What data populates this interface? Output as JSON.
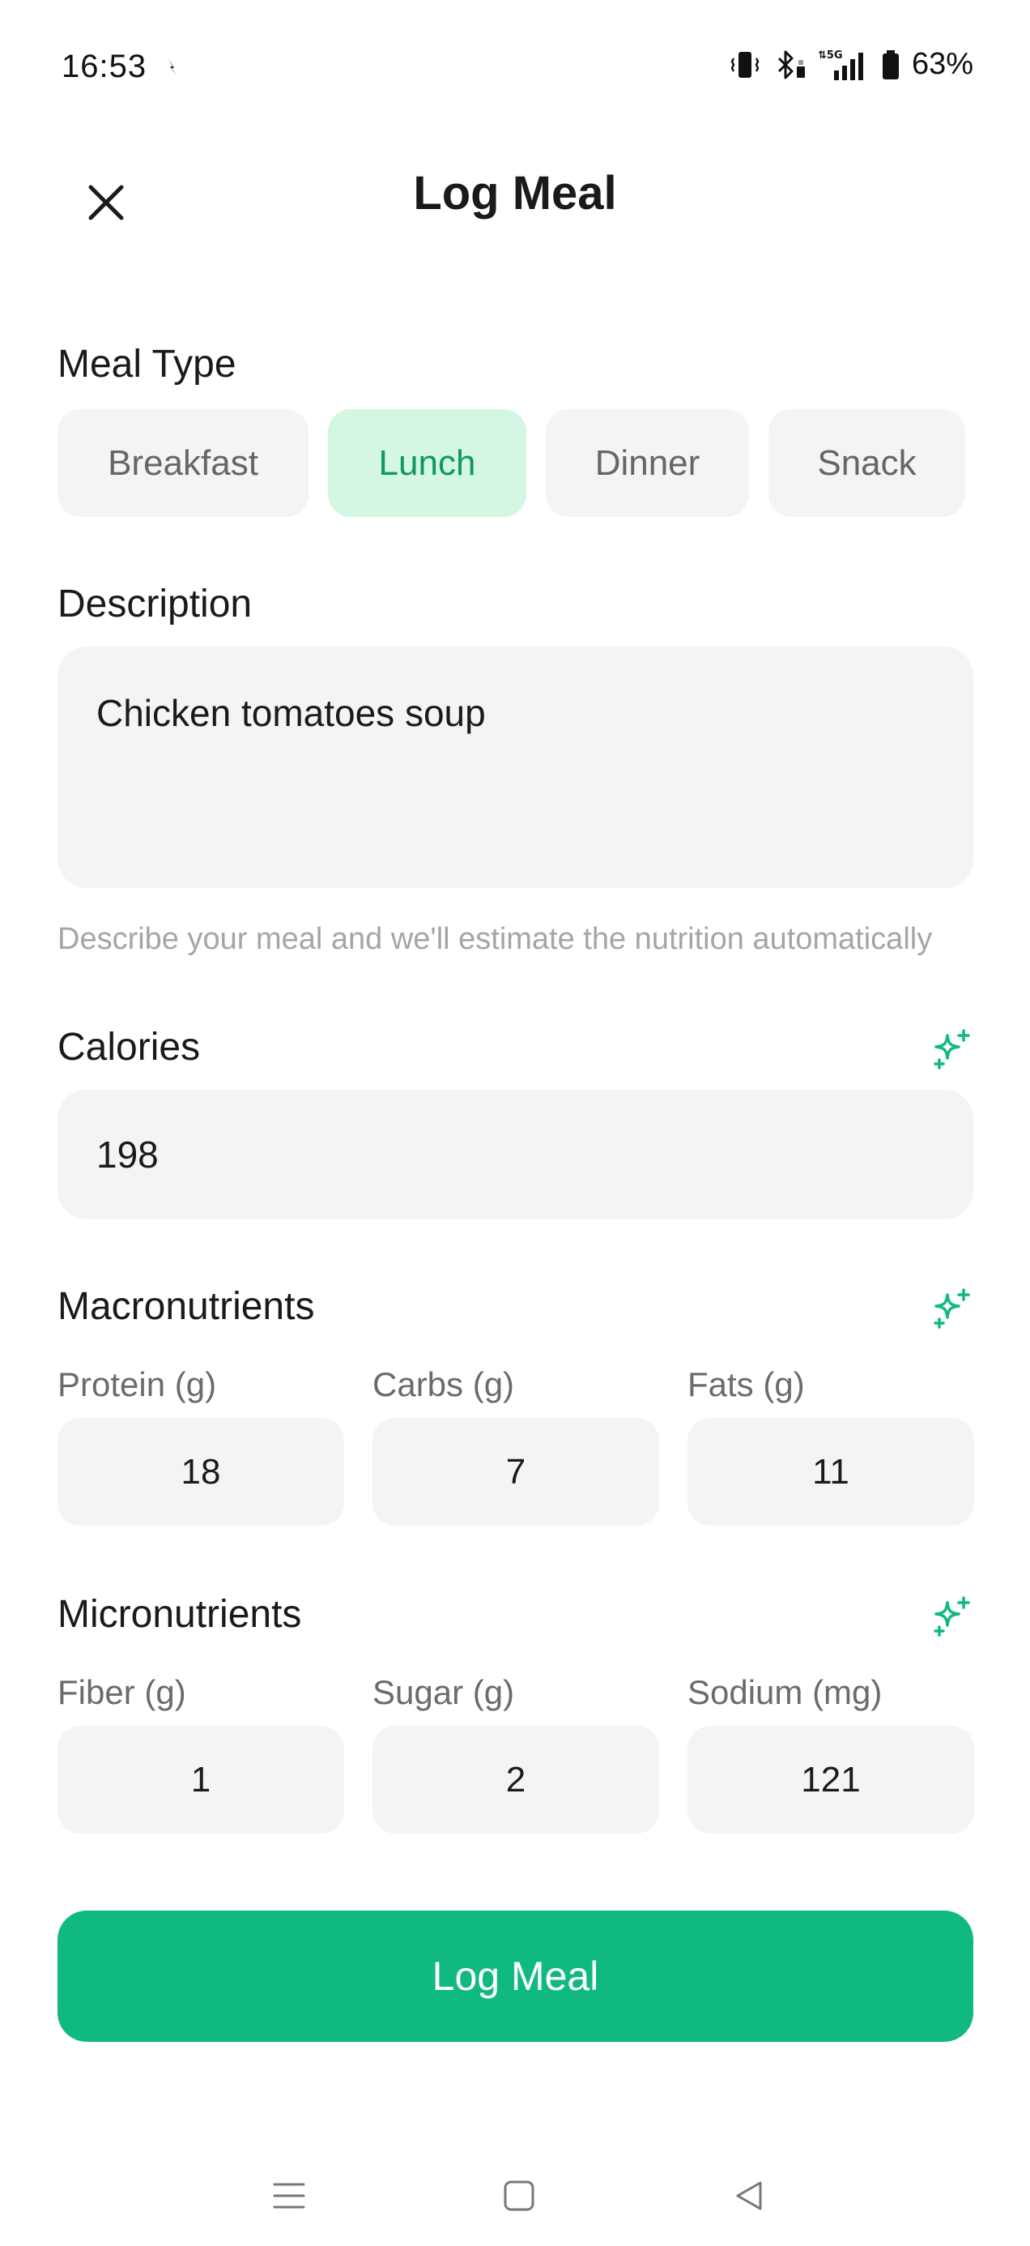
{
  "status_bar": {
    "time": "16:53",
    "battery": "63%",
    "icons": [
      "notification-icon",
      "vibrate-icon",
      "bluetooth-icon",
      "5g-signal-icon",
      "battery-icon"
    ]
  },
  "header": {
    "title": "Log Meal",
    "close_icon": "close-icon"
  },
  "meal_type": {
    "label": "Meal Type",
    "options": [
      "Breakfast",
      "Lunch",
      "Dinner",
      "Snack"
    ],
    "selected": "Lunch"
  },
  "description": {
    "label": "Description",
    "value": "Chicken tomatoes soup",
    "helper": "Describe your meal and we'll estimate the nutrition automatically"
  },
  "calories": {
    "label": "Calories",
    "value": "198"
  },
  "macronutrients": {
    "label": "Macronutrients",
    "protein_label": "Protein (g)",
    "protein_value": "18",
    "carbs_label": "Carbs (g)",
    "carbs_value": "7",
    "fats_label": "Fats (g)",
    "fats_value": "11"
  },
  "micronutrients": {
    "label": "Micronutrients",
    "fiber_label": "Fiber (g)",
    "fiber_value": "1",
    "sugar_label": "Sugar (g)",
    "sugar_value": "2",
    "sodium_label": "Sodium (mg)",
    "sodium_value": "121"
  },
  "submit": {
    "label": "Log Meal"
  },
  "colors": {
    "accent": "#10b981",
    "accent_text": "#0f9a5c",
    "chip_selected_bg": "#d3f7e2",
    "field_bg": "#f4f4f4"
  }
}
